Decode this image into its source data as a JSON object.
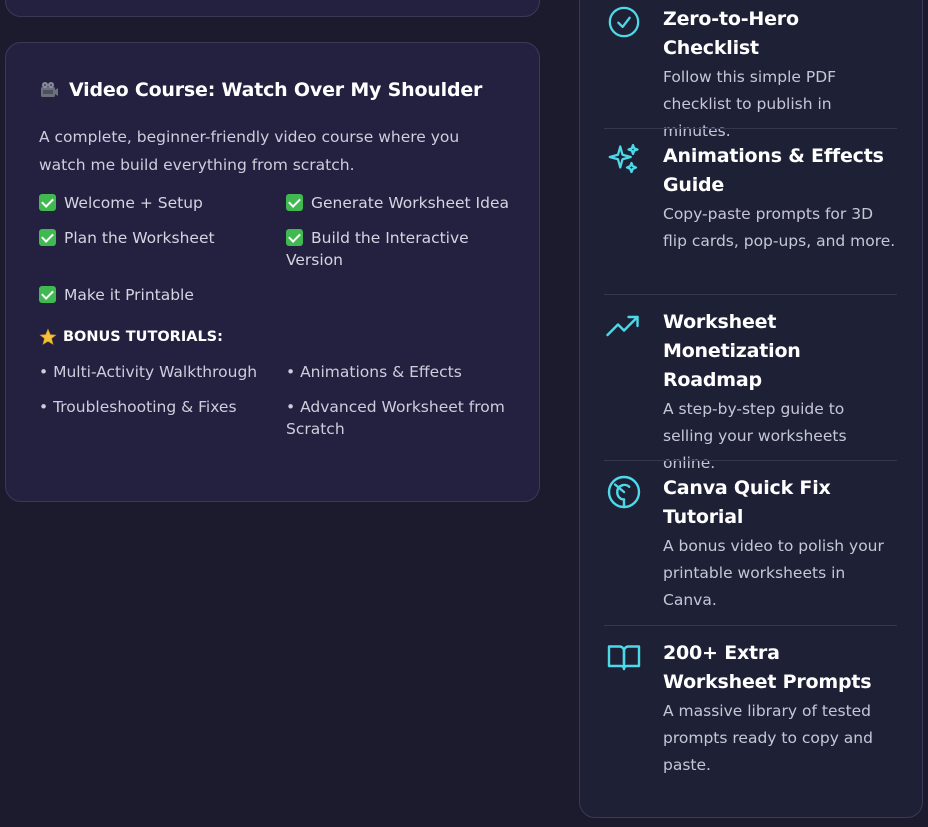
{
  "course": {
    "title": "Video Course: Watch Over My Shoulder",
    "description": "A complete, beginner-friendly video course where you watch me build everything from scratch.",
    "modules": [
      "Welcome + Setup",
      "Generate Worksheet Idea",
      "Plan the Worksheet",
      "Build the Interactive Version",
      "Make it Printable"
    ],
    "bonus_label": "BONUS TUTORIALS:",
    "bonus_items": [
      "• Multi-Activity Walkthrough",
      "• Animations & Effects",
      "• Troubleshooting & Fixes",
      "• Advanced Worksheet from Scratch"
    ]
  },
  "benefits": [
    {
      "icon": "check-circle-icon",
      "title": "Zero-to-Hero Checklist",
      "desc": "Follow this simple PDF checklist to publish in minutes."
    },
    {
      "icon": "sparkles-icon",
      "title": "Animations & Effects Guide",
      "desc": "Copy-paste prompts for 3D flip cards, pop-ups, and more."
    },
    {
      "icon": "trending-up-icon",
      "title": "Worksheet Monetization Roadmap",
      "desc": "A step-by-step guide to selling your worksheets online."
    },
    {
      "icon": "canva-icon",
      "title": "Canva Quick Fix Tutorial",
      "desc": "A bonus video to polish your printable worksheets in Canva."
    },
    {
      "icon": "book-open-icon",
      "title": "200+ Extra Worksheet Prompts",
      "desc": "A massive library of tested prompts ready to copy and paste."
    }
  ],
  "colors": {
    "background": "#1b1b2d",
    "card": "#23213f",
    "accent": "#4dd9e8",
    "check": "#3fb950"
  }
}
